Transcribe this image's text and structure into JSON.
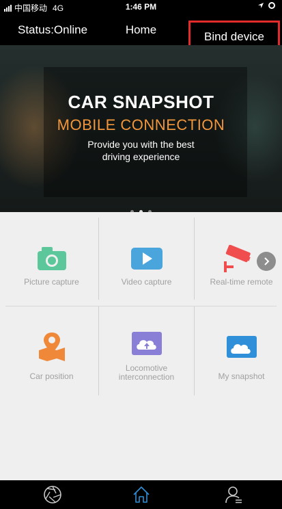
{
  "status_bar": {
    "carrier": "中国移动",
    "network": "4G",
    "time": "1:46 PM"
  },
  "navbar": {
    "status": "Status:Online",
    "title": "Home",
    "bind": "Bind device"
  },
  "banner": {
    "title": "CAR SNAPSHOT",
    "subtitle": "MOBILE  CONNECTION",
    "line1": "Provide you with the best",
    "line2": "driving experience"
  },
  "features": [
    {
      "label": "Picture capture",
      "icon": "camera-icon",
      "color": "#5cc79a"
    },
    {
      "label": "Video capture",
      "icon": "video-icon",
      "color": "#4aa5dc"
    },
    {
      "label": "Real-time remote",
      "icon": "cctv-icon",
      "color": "#f04e4e"
    },
    {
      "label": "Car position",
      "icon": "map-pin-icon",
      "color": "#f0883a"
    },
    {
      "label_line1": "Locomotive",
      "label_line2": "interconnection",
      "icon": "cloud-upload-icon",
      "color": "#8a7fd6"
    },
    {
      "label": "My snapshot",
      "icon": "cloud-photo-icon",
      "color": "#2f8fd8"
    }
  ],
  "tabs": [
    {
      "name": "aperture",
      "icon": "aperture-icon",
      "active": false
    },
    {
      "name": "home",
      "icon": "home-icon",
      "active": true
    },
    {
      "name": "profile",
      "icon": "user-icon",
      "active": false
    }
  ]
}
